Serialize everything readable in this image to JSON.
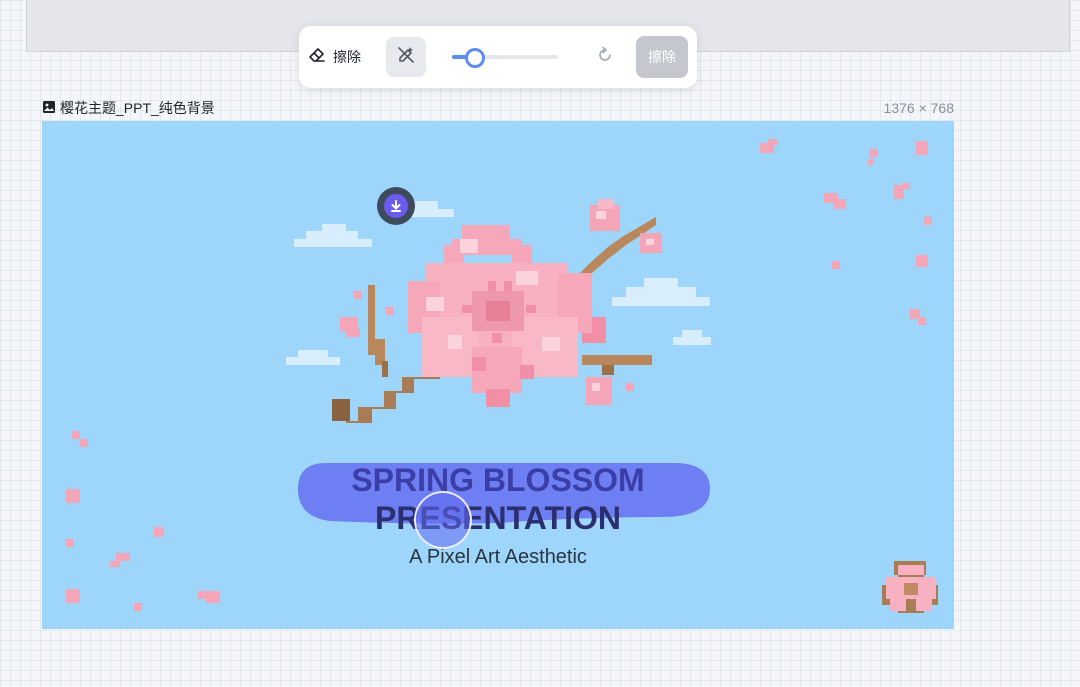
{
  "toolbar": {
    "erase_tool_label": "擦除",
    "brush_size_percent": 22,
    "submit_label": "擦除"
  },
  "file": {
    "name": "樱花主题_PPT_纯色背景",
    "dimensions": "1376 × 768"
  },
  "slide": {
    "title_line1": "SPRING BLOSSOM",
    "title_line2": "PRESENTATION",
    "subtitle": "A Pixel Art Aesthetic",
    "background_color": "#9ed6fb"
  },
  "colors": {
    "accent": "#5b8def",
    "mask": "#6470f0",
    "disabled_button": "#c4c7cd"
  },
  "icons": {
    "erase": "eraser-icon",
    "magic": "magic-erase-icon",
    "reset": "reset-icon",
    "file": "image-icon",
    "download": "download-icon"
  }
}
